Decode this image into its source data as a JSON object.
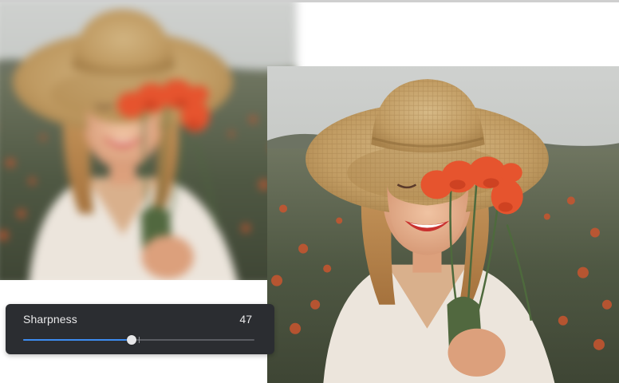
{
  "sharpness": {
    "label": "Sharpness",
    "value": "47",
    "level": 0.47,
    "accent_color": "#3d8cf0"
  },
  "images": {
    "before": {
      "name": "before-blurred-photo",
      "state": "blurred"
    },
    "after": {
      "name": "after-sharpened-photo",
      "state": "sharp"
    }
  }
}
